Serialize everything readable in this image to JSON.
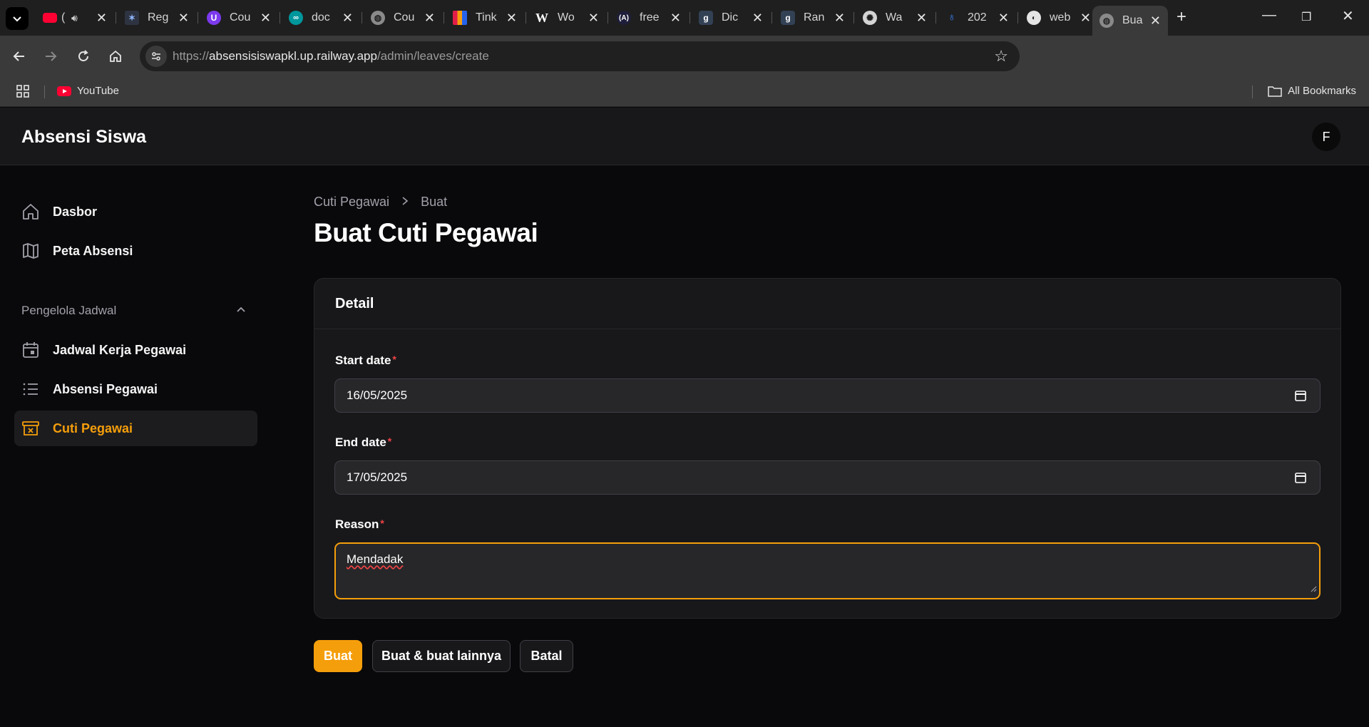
{
  "browser": {
    "tabs": [
      {
        "title": "(",
        "favicon_color": "#ff0033",
        "icon": "youtube-icon"
      },
      {
        "title": "Reg",
        "favicon_color": "#444a55",
        "icon": "regex-icon"
      },
      {
        "title": "Cou",
        "favicon_color": "#7c3aed",
        "icon": "udemy-icon"
      },
      {
        "title": "doc",
        "favicon_color": "#00979d",
        "icon": "arduino-icon"
      },
      {
        "title": "Cou",
        "favicon_color": "#8a8a8a",
        "icon": "globe-icon"
      },
      {
        "title": "Tink",
        "favicon_color": "#e11d48",
        "icon": "tinkercad-icon"
      },
      {
        "title": "Wo",
        "favicon_color": "#ffffff",
        "icon": "wikipedia-icon"
      },
      {
        "title": "free",
        "favicon_color": "#1e1e3a",
        "icon": "freecodecamp-icon"
      },
      {
        "title": "Dic",
        "favicon_color": "#334155",
        "icon": "git-icon"
      },
      {
        "title": "Ran",
        "favicon_color": "#334155",
        "icon": "git-icon"
      },
      {
        "title": "Wa",
        "favicon_color": "#d4d4d4",
        "icon": "openai-icon"
      },
      {
        "title": "202",
        "favicon_color": "#2563eb",
        "icon": "pin-icon"
      },
      {
        "title": "web",
        "favicon_color": "#e5e5e5",
        "icon": "web-icon"
      },
      {
        "title": "Bua",
        "favicon_color": "#8a8a8a",
        "icon": "globe-icon"
      }
    ],
    "url_scheme": "https://",
    "url_host": "absensisiswapkl.up.railway.app",
    "url_path": "/admin/leaves/create",
    "bookmark_youtube": "YouTube",
    "bookmark_all": "All Bookmarks"
  },
  "app": {
    "brand": "Absensi Siswa",
    "user_initial": "F"
  },
  "sidebar": {
    "items": [
      {
        "label": "Dasbor",
        "icon": "home-icon"
      },
      {
        "label": "Peta Absensi",
        "icon": "map-icon"
      }
    ],
    "group_label": "Pengelola Jadwal",
    "group_items": [
      {
        "label": "Jadwal Kerja Pegawai",
        "icon": "calendar-icon"
      },
      {
        "label": "Absensi Pegawai",
        "icon": "list-icon"
      },
      {
        "label": "Cuti Pegawai",
        "icon": "archive-x-icon",
        "active": true
      }
    ],
    "accent": "#f59e0b"
  },
  "main": {
    "breadcrumb": [
      "Cuti Pegawai",
      "Buat"
    ],
    "title": "Buat Cuti Pegawai",
    "card_title": "Detail",
    "fields": {
      "start_date_label": "Start date",
      "start_date_value": "16/05/2025",
      "end_date_label": "End date",
      "end_date_value": "17/05/2025",
      "reason_label": "Reason",
      "reason_value": "Mendadak",
      "required_mark": "*"
    },
    "buttons": {
      "create": "Buat",
      "create_another": "Buat & buat lainnya",
      "cancel": "Batal"
    }
  }
}
